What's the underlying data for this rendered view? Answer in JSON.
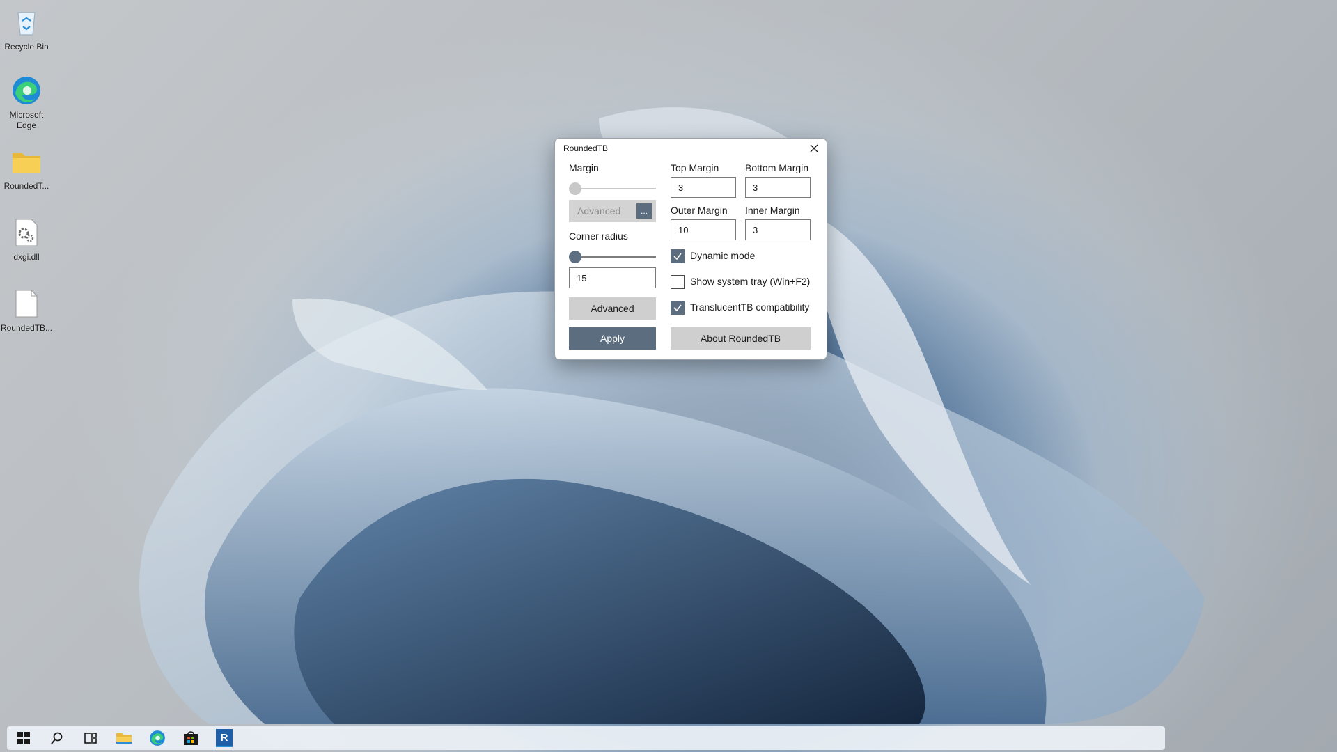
{
  "desktop": {
    "icons": [
      {
        "label": "Recycle Bin",
        "icon": "recycle-bin-icon"
      },
      {
        "label": "Microsoft Edge",
        "icon": "edge-icon"
      },
      {
        "label": "RoundedT...",
        "icon": "folder-icon"
      },
      {
        "label": "dxgi.dll",
        "icon": "dll-file-icon"
      },
      {
        "label": "RoundedTB...",
        "icon": "file-icon"
      }
    ]
  },
  "dialog": {
    "title": "RoundedTB",
    "close_icon": "close-icon",
    "margin_label": "Margin",
    "margin_advanced_label": "Advanced",
    "margin_more_label": "...",
    "corner_radius_label": "Corner radius",
    "corner_radius_value": "15",
    "advanced_button": "Advanced",
    "apply_button": "Apply",
    "top_margin_label": "Top Margin",
    "top_margin_value": "3",
    "bottom_margin_label": "Bottom Margin",
    "bottom_margin_value": "3",
    "outer_margin_label": "Outer Margin",
    "outer_margin_value": "10",
    "inner_margin_label": "Inner Margin",
    "inner_margin_value": "3",
    "dynamic_mode_label": "Dynamic mode",
    "dynamic_mode_checked": true,
    "system_tray_label": "Show system tray (Win+F2)",
    "system_tray_checked": false,
    "translucenttb_label": "TranslucentTB compatibility",
    "translucenttb_checked": true,
    "about_button": "About RoundedTB",
    "accent_color": "#5b6d7e"
  },
  "taskbar": {
    "items": [
      "start-icon",
      "search-icon",
      "task-view-icon",
      "file-explorer-icon",
      "edge-icon",
      "store-icon",
      "roundedtb-icon"
    ],
    "roundedtb_letter": "R"
  }
}
